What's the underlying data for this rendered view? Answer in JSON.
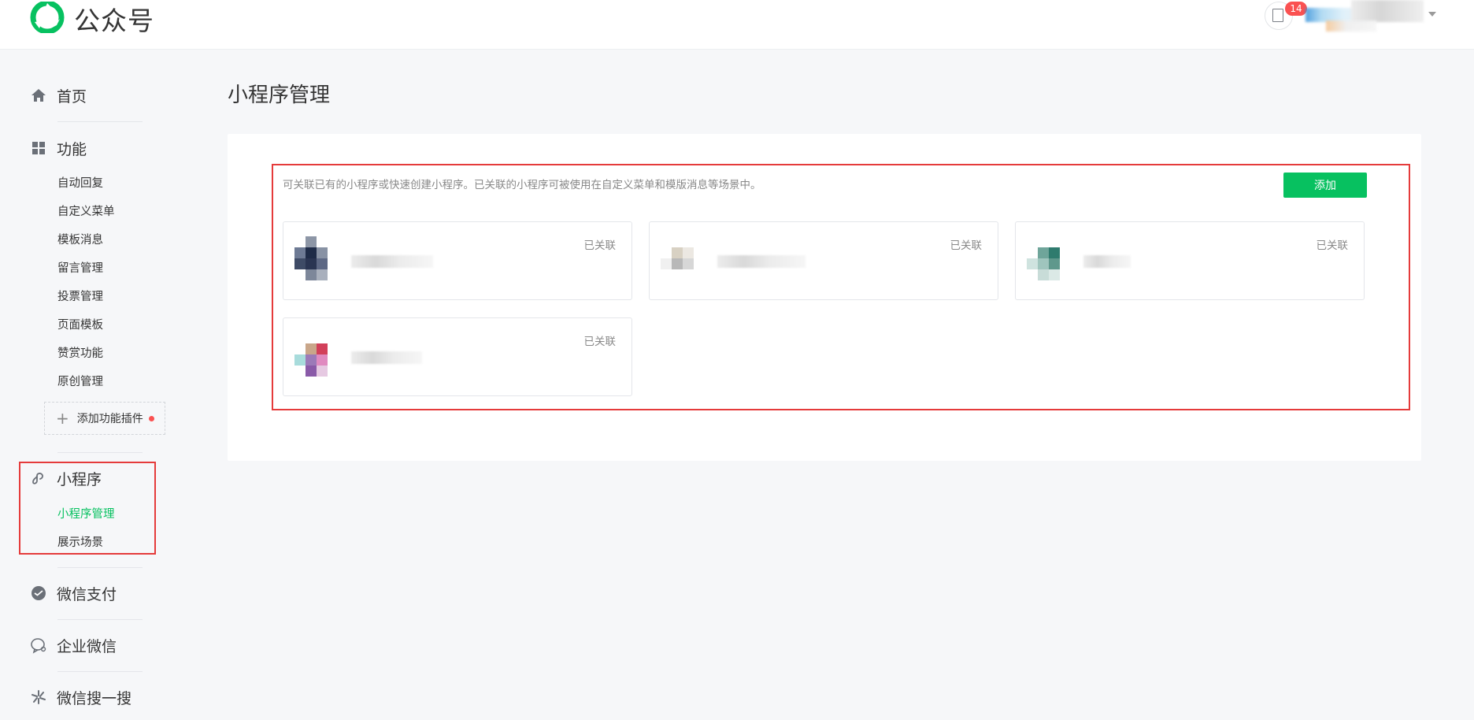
{
  "header": {
    "logo_text": "公众号",
    "notice_count": "14",
    "brand_color": "#07c160"
  },
  "sidebar": {
    "home": {
      "label": "首页",
      "icon": "home-icon"
    },
    "features": {
      "label": "功能",
      "icon": "grid-icon",
      "items": [
        {
          "label": "自动回复"
        },
        {
          "label": "自定义菜单"
        },
        {
          "label": "模板消息"
        },
        {
          "label": "留言管理"
        },
        {
          "label": "投票管理"
        },
        {
          "label": "页面模板"
        },
        {
          "label": "赞赏功能"
        },
        {
          "label": "原创管理"
        }
      ],
      "add_plugin_label": "添加功能插件"
    },
    "miniprogram": {
      "label": "小程序",
      "icon": "miniprogram-icon",
      "items": [
        {
          "label": "小程序管理",
          "active": true
        },
        {
          "label": "展示场景",
          "active": false
        }
      ]
    },
    "wechat_pay": {
      "label": "微信支付",
      "icon": "wechat-pay-icon"
    },
    "work_wechat": {
      "label": "企业微信",
      "icon": "work-wechat-icon"
    },
    "search": {
      "label": "微信搜一搜",
      "icon": "search-sparkle-icon"
    }
  },
  "main": {
    "title": "小程序管理",
    "description": "可关联已有的小程序或快速创建小程序。已关联的小程序可被使用在自定义菜单和模版消息等场景中。",
    "add_button": "添加",
    "cards": [
      {
        "status": "已关联"
      },
      {
        "status": "已关联"
      },
      {
        "status": "已关联"
      },
      {
        "status": "已关联"
      }
    ]
  },
  "colors": {
    "highlight": "#e53b3b",
    "active_green": "#07c160"
  }
}
